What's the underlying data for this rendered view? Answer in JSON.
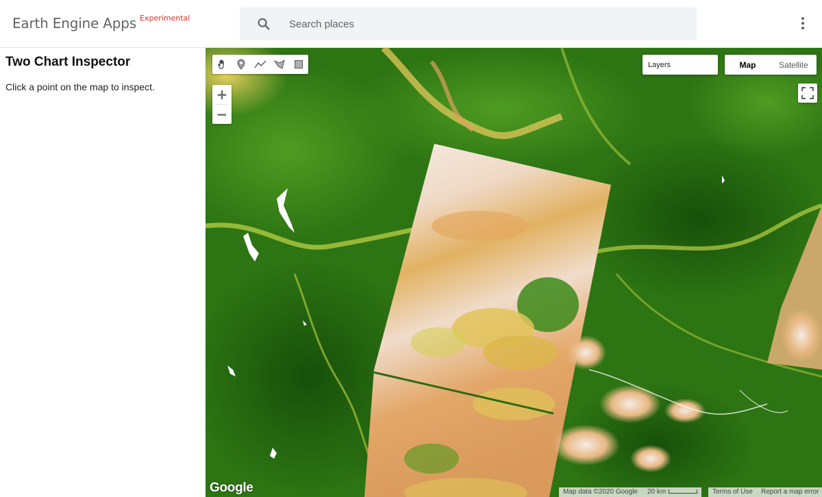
{
  "header": {
    "app_title": "Earth Engine Apps",
    "app_tag": "Experimental",
    "search_placeholder": "Search places",
    "search_value": ""
  },
  "panel": {
    "title": "Two Chart Inspector",
    "hint": "Click a point on the map to inspect."
  },
  "map": {
    "drawing_tools": [
      {
        "name": "hand-icon"
      },
      {
        "name": "point-marker-icon"
      },
      {
        "name": "line-icon"
      },
      {
        "name": "polygon-icon"
      },
      {
        "name": "rectangle-icon"
      }
    ],
    "zoom_in_label": "+",
    "zoom_out_label": "−",
    "layers_label": "Layers",
    "map_type": {
      "map_label": "Map",
      "satellite_label": "Satellite",
      "selected": "Map"
    },
    "logo_text": "Google",
    "attribution": {
      "data_text": "Map data ©2020 Google",
      "scale_text": "20 km",
      "terms_text": "Terms of Use",
      "report_text": "Report a map error"
    }
  },
  "colors": {
    "vegetation_dark": "#1f5c0c",
    "vegetation_mid": "#3c8a1a",
    "vegetation_light": "#8ab832",
    "bare_yellow": "#e2c45a",
    "bare_tan": "#d99a5c",
    "bare_pale": "#f4e8de",
    "tag_red": "#d93025"
  }
}
